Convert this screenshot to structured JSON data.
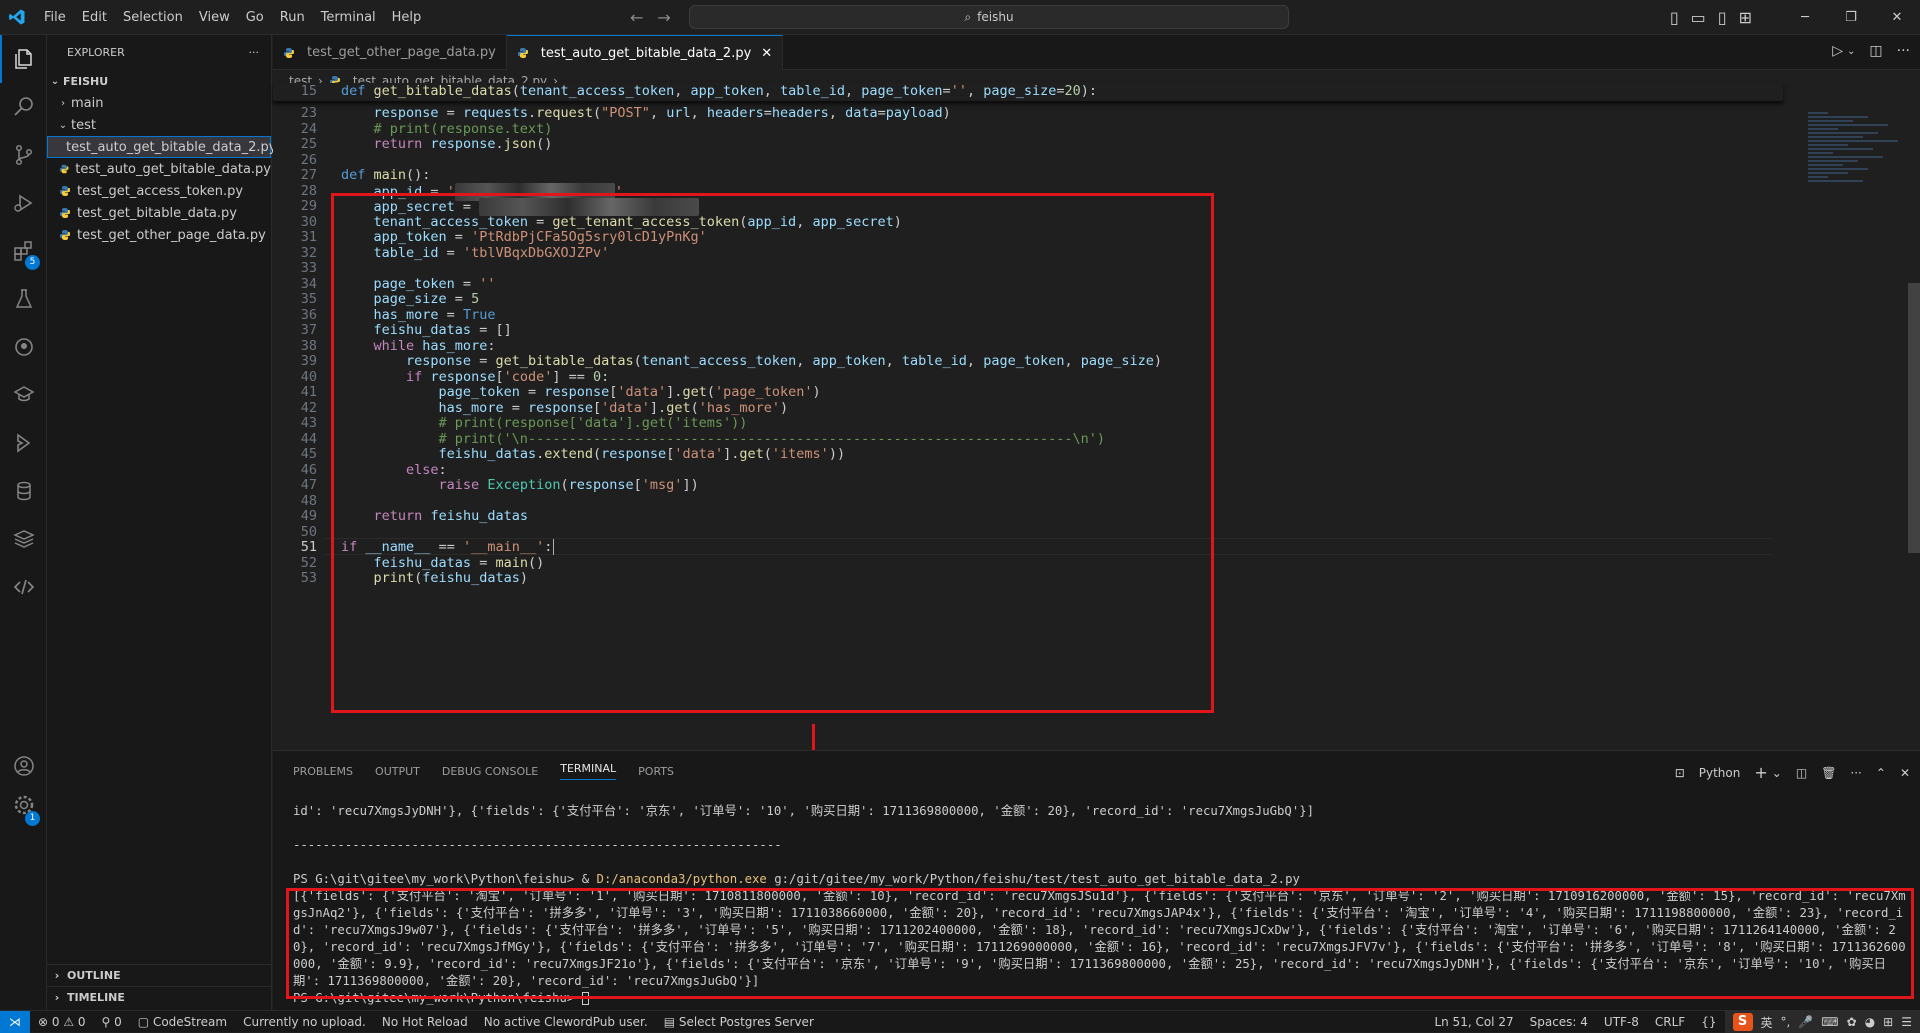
{
  "titlebar": {
    "menu": [
      "File",
      "Edit",
      "Selection",
      "View",
      "Go",
      "Run",
      "Terminal",
      "Help"
    ],
    "search_text": "feishu"
  },
  "sidebar": {
    "title": "EXPLORER",
    "root": "FEISHU",
    "folders": [
      "main",
      "test"
    ],
    "files": [
      "test_auto_get_bitable_data_2.py",
      "test_auto_get_bitable_data.py",
      "test_get_access_token.py",
      "test_get_bitable_data.py",
      "test_get_other_page_data.py"
    ],
    "outline": "OUTLINE",
    "timeline": "TIMELINE"
  },
  "activitybar": {
    "extensions_badge": "5",
    "accounts_badge": "1"
  },
  "tabs": [
    "test_get_other_page_data.py",
    "test_auto_get_bitable_data_2.py"
  ],
  "breadcrumb": [
    "test",
    "test_auto_get_bitable_data_2.py",
    "..."
  ],
  "code": {
    "sticky_header": "def get_bitable_datas(tenant_access_token, app_token, table_id, page_token='', page_size=20):",
    "line_numbers": [
      "15",
      "23",
      "24",
      "25",
      "26",
      "27",
      "28",
      "29",
      "30",
      "31",
      "32",
      "33",
      "34",
      "35",
      "36",
      "37",
      "38",
      "39",
      "40",
      "41",
      "42",
      "43",
      "44",
      "45",
      "46",
      "47",
      "48",
      "49",
      "50",
      "51",
      "52",
      "53"
    ],
    "lines": [
      "def get_bitable_datas(tenant_access_token, app_token, table_id, page_token='', page_size=20):",
      "    response = requests.request(\"POST\", url, headers=headers, data=payload)",
      "    # print(response.text)",
      "    return response.json()",
      "",
      "def main():",
      "    app_id = '",
      "    app_secret = ",
      "    tenant_access_token = get_tenant_access_token(app_id, app_secret)",
      "    app_token = 'PtRdbPjCFa5Og5sry0lcD1yPnKg'",
      "    table_id = 'tblVBqxDbGXOJZPv'",
      "",
      "    page_token = ''",
      "    page_size = 5",
      "    has_more = True",
      "    feishu_datas = []",
      "    while has_more:",
      "        response = get_bitable_datas(tenant_access_token, app_token, table_id, page_token, page_size)",
      "        if response['code'] == 0:",
      "            page_token = response['data'].get('page_token')",
      "            has_more = response['data'].get('has_more')",
      "            # print(response['data'].get('items'))",
      "            # print('\\n-------------------------------------------------------------------\\n')",
      "            feishu_datas.extend(response['data'].get('items'))",
      "        else:",
      "            raise Exception(response['msg'])",
      "",
      "    return feishu_datas",
      "",
      "if __name__ == '__main__':",
      "    feishu_datas = main()",
      "    print(feishu_datas)"
    ]
  },
  "panel": {
    "tabs": [
      "PROBLEMS",
      "OUTPUT",
      "DEBUG CONSOLE",
      "TERMINAL",
      "PORTS"
    ],
    "terminal_kind": "Python",
    "terminal_lines": {
      "prev_output": "id': 'recu7XmgsJyDNH'}, {'fields': {'支付平台': '京东', '订单号': '10', '购买日期': 1711369800000, '金额': 20}, 'record_id': 'recu7XmgsJuGbQ'}]",
      "separator": "------------------------------------------------------------------",
      "prompt1": "PS G:\\git\\gitee\\my_work\\Python\\feishu> & ",
      "exe": "D:/anaconda3/python.exe",
      "script": " g:/git/gitee/my_work/Python/feishu/test/test_auto_get_bitable_data_2.py",
      "output": "[{'fields': {'支付平台': '淘宝', '订单号': '1', '购买日期': 1710811800000, '金额': 10}, 'record_id': 'recu7XmgsJSu1d'}, {'fields': {'支付平台': '京东', '订单号': '2', '购买日期': 1710916200000, '金额': 15}, 'record_id': 'recu7XmgsJnAq2'}, {'fields': {'支付平台': '拼多多', '订单号': '3', '购买日期': 1711038660000, '金额': 20}, 'record_id': 'recu7XmgsJAP4x'}, {'fields': {'支付平台': '淘宝', '订单号': '4', '购买日期': 1711198800000, '金额': 23}, 'record_id': 'recu7XmgsJ9w07'}, {'fields': {'支付平台': '拼多多', '订单号': '5', '购买日期': 1711202400000, '金额': 18}, 'record_id': 'recu7XmgsJCxDw'}, {'fields': {'支付平台': '淘宝', '订单号': '6', '购买日期': 1711264140000, '金额': 20}, 'record_id': 'recu7XmgsJfMGy'}, {'fields': {'支付平台': '拼多多', '订单号': '7', '购买日期': 1711269000000, '金额': 16}, 'record_id': 'recu7XmgsJFV7v'}, {'fields': {'支付平台': '拼多多', '订单号': '8', '购买日期': 1711362600000, '金额': 9.9}, 'record_id': 'recu7XmgsJF21o'}, {'fields': {'支付平台': '京东', '订单号': '9', '购买日期': 1711369800000, '金额': 25}, 'record_id': 'recu7XmgsJyDNH'}, {'fields': {'支付平台': '京东', '订单号': '10', '购买日期': 1711369800000, '金额': 20}, 'record_id': 'recu7XmgsJuGbQ'}]",
      "prompt2": "PS G:\\git\\gitee\\my_work\\Python\\feishu> "
    }
  },
  "statusbar": {
    "errors": "0",
    "warnings": "0",
    "ports": "0",
    "codestream": "CodeStream",
    "upload": "Currently no upload.",
    "hotreload": "No Hot Reload",
    "clewd": "No active ClewordPub user.",
    "postgres": "Select Postgres Server",
    "position": "Ln 51, Col 27",
    "spaces": "Spaces: 4",
    "encoding": "UTF-8",
    "eol": "CRLF",
    "ime_lang": "英"
  },
  "colors": {
    "accent": "#0078d4",
    "highlight_box": "#e0161a",
    "exe_path": "#e5c07b"
  }
}
